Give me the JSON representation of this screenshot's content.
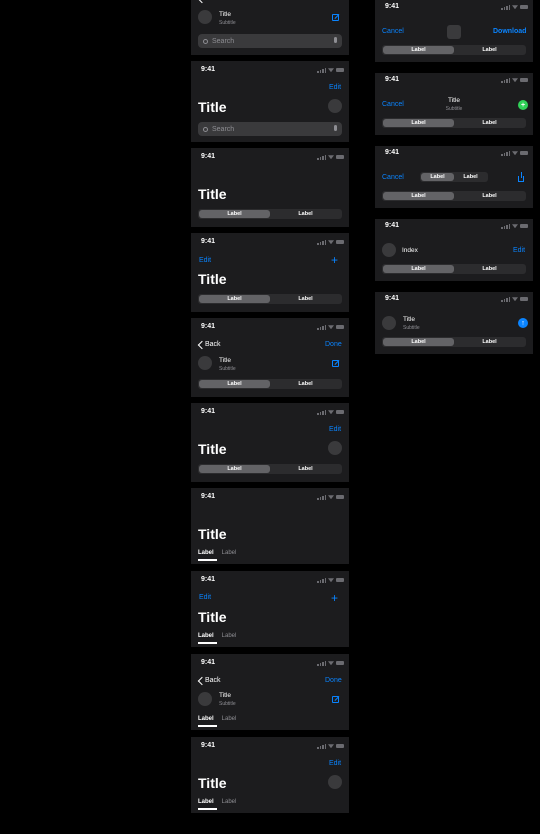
{
  "status": {
    "time": "9:41"
  },
  "nav": {
    "back": "Back",
    "done": "Done",
    "edit": "Edit",
    "cancel": "Cancel",
    "download": "Download"
  },
  "content": {
    "title": "Title",
    "subtitle": "Subtitle",
    "index": "Index"
  },
  "search": {
    "placeholder": "Search"
  },
  "segmented": {
    "first": "Label",
    "second": "Label"
  },
  "tabs": {
    "first": "Label",
    "second": "Label"
  },
  "icons": {
    "back": "chevron-left-icon",
    "compose": "compose-icon",
    "add": "plus-icon",
    "share": "share-icon",
    "mic": "microphone-icon",
    "search": "magnifier-icon",
    "upload": "arrow-up-circle-icon",
    "add-green": "plus-circle-icon"
  },
  "colors": {
    "background": "#000000",
    "panel": "#1c1c1e",
    "accent": "#0a84ff",
    "green": "#30d158",
    "secondary": "#8e8e93"
  }
}
